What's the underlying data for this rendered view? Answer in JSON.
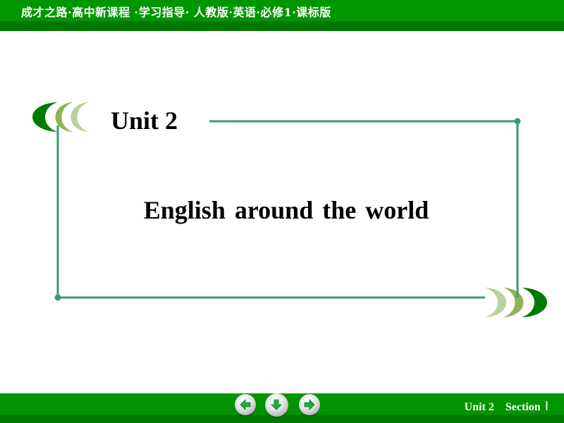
{
  "header": {
    "title": "成才之路·高中新课程 ·学习指导· 人教版·英语·必修1·课标版"
  },
  "slide": {
    "unit_title": "Unit 2",
    "main_title": "English around the world"
  },
  "colors": {
    "bar_green": "#009600",
    "bar_stripe": "#007800",
    "frame_line": "#3a9a6a",
    "crescent_dark": "#007a00",
    "crescent_mid": "#8fb552",
    "crescent_light": "#b7d29a"
  },
  "footer": {
    "nav": [
      {
        "icon": "arrow-left-icon",
        "action": "previous"
      },
      {
        "icon": "arrow-down-icon",
        "action": "home"
      },
      {
        "icon": "arrow-right-icon",
        "action": "next"
      }
    ],
    "unit_label": "Unit 2",
    "section_label": "Section",
    "section_number": "Ⅰ"
  }
}
